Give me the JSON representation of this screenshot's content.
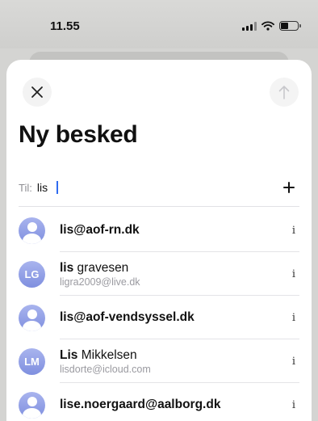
{
  "status_bar": {
    "time": "11.55",
    "battery_level": 0.45
  },
  "header": {
    "title": "Ny besked"
  },
  "to_field": {
    "label": "Til:",
    "value": "lis"
  },
  "contacts": [
    {
      "match": "lis@aof-rn.dk",
      "rest": "",
      "email": "",
      "initials": ""
    },
    {
      "match": "lis",
      "rest": " gravesen",
      "email": "ligra2009@live.dk",
      "initials": "LG"
    },
    {
      "match": "lis@aof-vendsyssel.dk",
      "rest": "",
      "email": "",
      "initials": ""
    },
    {
      "match": "Lis",
      "rest": " Mikkelsen",
      "email": "lisdorte@icloud.com",
      "initials": "LM"
    },
    {
      "match": "lise.noergaard@aalborg.dk",
      "rest": "",
      "email": "",
      "initials": ""
    }
  ],
  "info_glyph": "i",
  "colors": {
    "accent": "#2f6bf0",
    "avatar": "#8f9ce6",
    "subtext": "#9a9aa0"
  }
}
